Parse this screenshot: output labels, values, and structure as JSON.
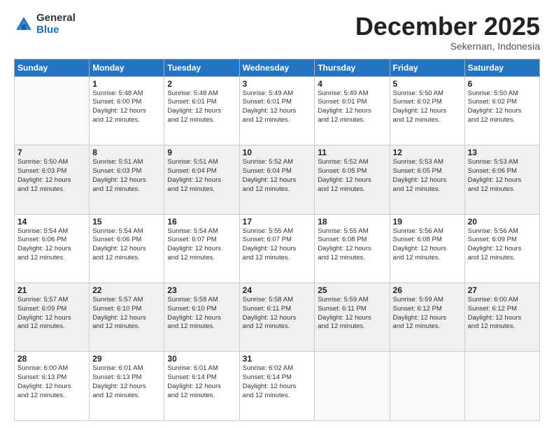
{
  "header": {
    "logo_general": "General",
    "logo_blue": "Blue",
    "month": "December 2025",
    "location": "Sekernan, Indonesia"
  },
  "days_of_week": [
    "Sunday",
    "Monday",
    "Tuesday",
    "Wednesday",
    "Thursday",
    "Friday",
    "Saturday"
  ],
  "weeks": [
    [
      {
        "day": "",
        "info": ""
      },
      {
        "day": "1",
        "info": "Sunrise: 5:48 AM\nSunset: 6:00 PM\nDaylight: 12 hours\nand 12 minutes."
      },
      {
        "day": "2",
        "info": "Sunrise: 5:48 AM\nSunset: 6:01 PM\nDaylight: 12 hours\nand 12 minutes."
      },
      {
        "day": "3",
        "info": "Sunrise: 5:49 AM\nSunset: 6:01 PM\nDaylight: 12 hours\nand 12 minutes."
      },
      {
        "day": "4",
        "info": "Sunrise: 5:49 AM\nSunset: 6:01 PM\nDaylight: 12 hours\nand 12 minutes."
      },
      {
        "day": "5",
        "info": "Sunrise: 5:50 AM\nSunset: 6:02 PM\nDaylight: 12 hours\nand 12 minutes."
      },
      {
        "day": "6",
        "info": "Sunrise: 5:50 AM\nSunset: 6:02 PM\nDaylight: 12 hours\nand 12 minutes."
      }
    ],
    [
      {
        "day": "7",
        "info": ""
      },
      {
        "day": "8",
        "info": "Sunrise: 5:51 AM\nSunset: 6:03 PM\nDaylight: 12 hours\nand 12 minutes."
      },
      {
        "day": "9",
        "info": "Sunrise: 5:51 AM\nSunset: 6:04 PM\nDaylight: 12 hours\nand 12 minutes."
      },
      {
        "day": "10",
        "info": "Sunrise: 5:52 AM\nSunset: 6:04 PM\nDaylight: 12 hours\nand 12 minutes."
      },
      {
        "day": "11",
        "info": "Sunrise: 5:52 AM\nSunset: 6:05 PM\nDaylight: 12 hours\nand 12 minutes."
      },
      {
        "day": "12",
        "info": "Sunrise: 5:53 AM\nSunset: 6:05 PM\nDaylight: 12 hours\nand 12 minutes."
      },
      {
        "day": "13",
        "info": "Sunrise: 5:53 AM\nSunset: 6:06 PM\nDaylight: 12 hours\nand 12 minutes."
      }
    ],
    [
      {
        "day": "14",
        "info": ""
      },
      {
        "day": "15",
        "info": "Sunrise: 5:54 AM\nSunset: 6:06 PM\nDaylight: 12 hours\nand 12 minutes."
      },
      {
        "day": "16",
        "info": "Sunrise: 5:54 AM\nSunset: 6:07 PM\nDaylight: 12 hours\nand 12 minutes."
      },
      {
        "day": "17",
        "info": "Sunrise: 5:55 AM\nSunset: 6:07 PM\nDaylight: 12 hours\nand 12 minutes."
      },
      {
        "day": "18",
        "info": "Sunrise: 5:55 AM\nSunset: 6:08 PM\nDaylight: 12 hours\nand 12 minutes."
      },
      {
        "day": "19",
        "info": "Sunrise: 5:56 AM\nSunset: 6:08 PM\nDaylight: 12 hours\nand 12 minutes."
      },
      {
        "day": "20",
        "info": "Sunrise: 5:56 AM\nSunset: 6:09 PM\nDaylight: 12 hours\nand 12 minutes."
      }
    ],
    [
      {
        "day": "21",
        "info": ""
      },
      {
        "day": "22",
        "info": "Sunrise: 5:57 AM\nSunset: 6:10 PM\nDaylight: 12 hours\nand 12 minutes."
      },
      {
        "day": "23",
        "info": "Sunrise: 5:58 AM\nSunset: 6:10 PM\nDaylight: 12 hours\nand 12 minutes."
      },
      {
        "day": "24",
        "info": "Sunrise: 5:58 AM\nSunset: 6:11 PM\nDaylight: 12 hours\nand 12 minutes."
      },
      {
        "day": "25",
        "info": "Sunrise: 5:59 AM\nSunset: 6:11 PM\nDaylight: 12 hours\nand 12 minutes."
      },
      {
        "day": "26",
        "info": "Sunrise: 5:59 AM\nSunset: 6:12 PM\nDaylight: 12 hours\nand 12 minutes."
      },
      {
        "day": "27",
        "info": "Sunrise: 6:00 AM\nSunset: 6:12 PM\nDaylight: 12 hours\nand 12 minutes."
      }
    ],
    [
      {
        "day": "28",
        "info": "Sunrise: 6:00 AM\nSunset: 6:13 PM\nDaylight: 12 hours\nand 12 minutes."
      },
      {
        "day": "29",
        "info": "Sunrise: 6:01 AM\nSunset: 6:13 PM\nDaylight: 12 hours\nand 12 minutes."
      },
      {
        "day": "30",
        "info": "Sunrise: 6:01 AM\nSunset: 6:14 PM\nDaylight: 12 hours\nand 12 minutes."
      },
      {
        "day": "31",
        "info": "Sunrise: 6:02 AM\nSunset: 6:14 PM\nDaylight: 12 hours\nand 12 minutes."
      },
      {
        "day": "",
        "info": ""
      },
      {
        "day": "",
        "info": ""
      },
      {
        "day": "",
        "info": ""
      }
    ]
  ],
  "week7_sunday": {
    "info": "Sunrise: 5:50 AM\nSunset: 6:03 PM\nDaylight: 12 hours\nand 12 minutes."
  },
  "week14_sunday": {
    "info": "Sunrise: 5:54 AM\nSunset: 6:06 PM\nDaylight: 12 hours\nand 12 minutes."
  },
  "week21_sunday": {
    "info": "Sunrise: 5:57 AM\nSunset: 6:09 PM\nDaylight: 12 hours\nand 12 minutes."
  }
}
